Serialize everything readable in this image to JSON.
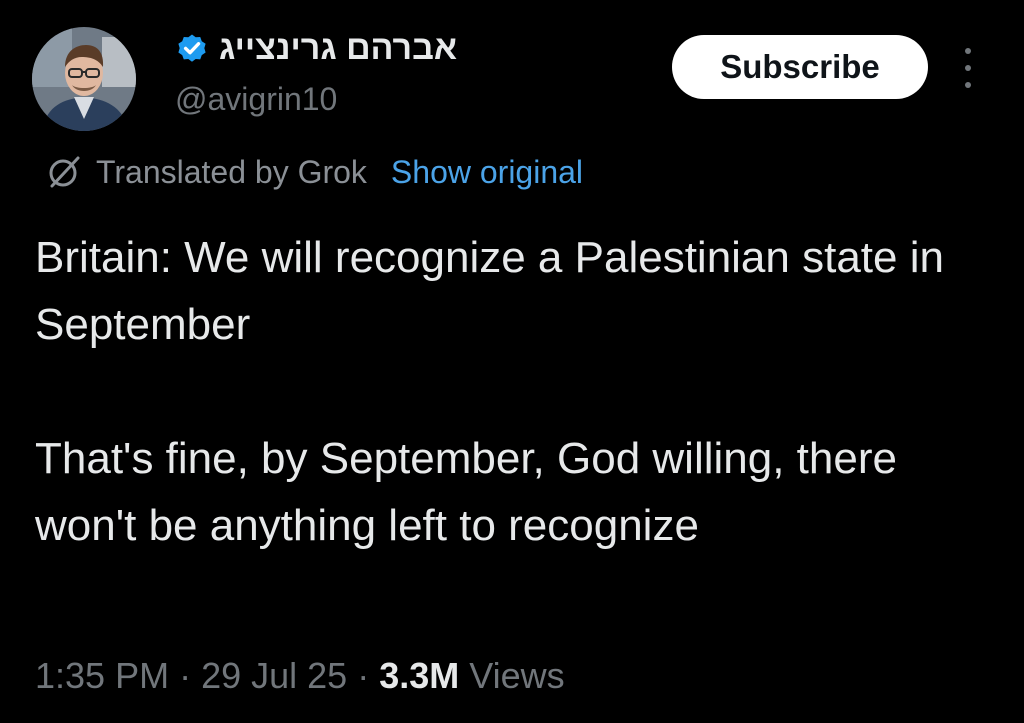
{
  "author": {
    "display_name": "אברהם גרינצייג",
    "handle": "@avigrin10",
    "verified": true,
    "verified_color": "#1d9bf0"
  },
  "actions": {
    "subscribe_label": "Subscribe",
    "more_icon": "more-vertical-icon"
  },
  "translation": {
    "icon": "grok-icon",
    "label": "Translated by Grok",
    "show_original_label": "Show original",
    "link_color": "#4ba3e8"
  },
  "tweet": {
    "paragraphs": [
      "Britain: We will recognize a Palestinian state in September",
      "That's fine, by September, God willing, there won't be anything left to recognize"
    ]
  },
  "meta": {
    "time": "1:35 PM",
    "separator": " · ",
    "date": "29 Jul 25",
    "views_count": "3.3M",
    "views_label": "Views"
  }
}
